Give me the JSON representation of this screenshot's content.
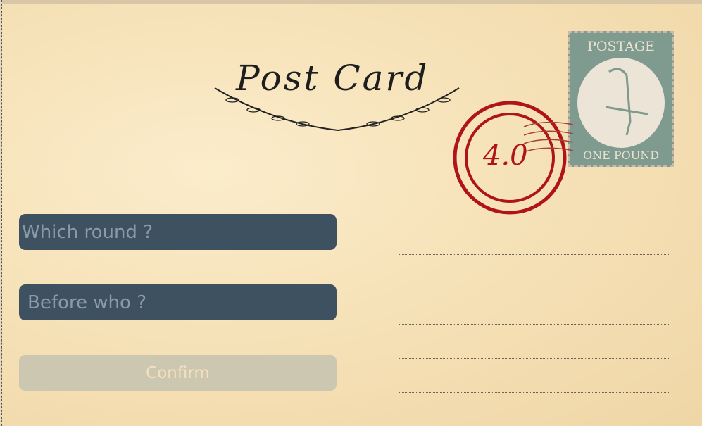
{
  "header": {
    "title": "Post Card"
  },
  "stamp": {
    "top_text": "POSTAGE",
    "bottom_text": "ONE POUND",
    "icon": "bird-icon"
  },
  "postmark": {
    "version": "4.0",
    "color": "#b0141a"
  },
  "form": {
    "round_placeholder": "Which round ?",
    "before_placeholder": "Before who ?",
    "confirm_label": "Confirm"
  },
  "colors": {
    "field_bg": "#3e5161",
    "button_bg": "#ccc7b0"
  }
}
